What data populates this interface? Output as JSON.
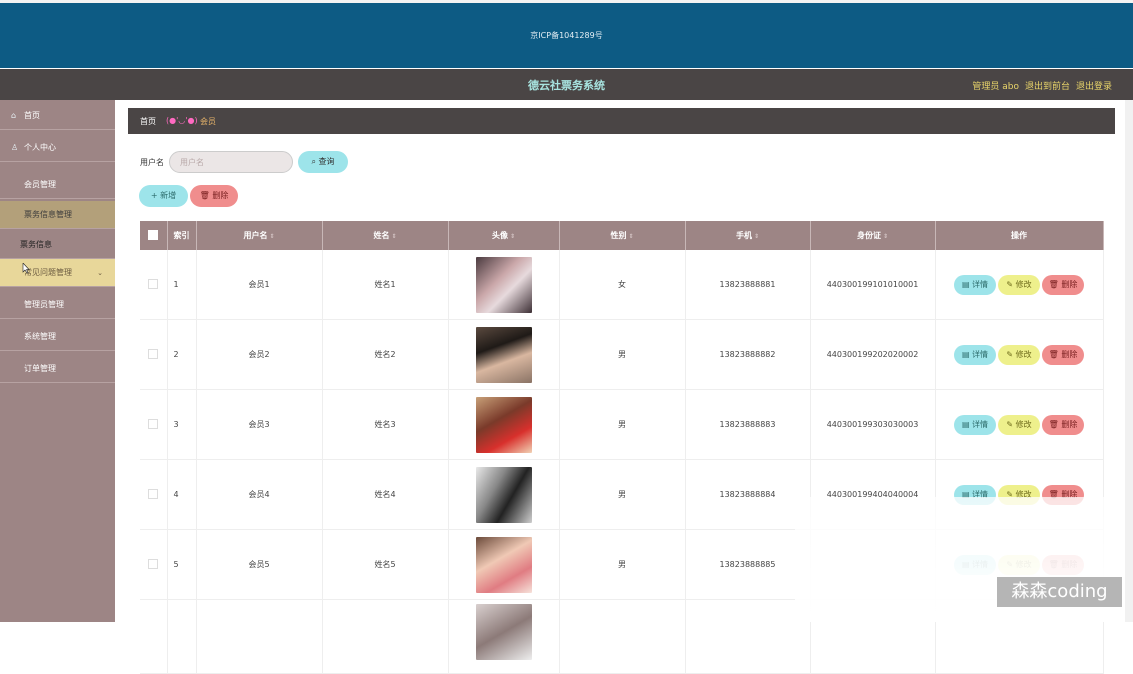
{
  "top": {
    "icp": "京ICP备1041289号"
  },
  "nav": {
    "title": "德云社票务系统",
    "admin": "管理员 abo",
    "back": "退出到前台",
    "logout": "退出登录"
  },
  "sidebar": {
    "items": [
      {
        "label": "首页",
        "icon": "home-icon"
      },
      {
        "label": "个人中心",
        "icon": "user-icon"
      },
      {
        "label": "会员管理",
        "icon": ""
      },
      {
        "label": "票务信息管理",
        "icon": ""
      },
      {
        "label": "票务信息",
        "icon": ""
      },
      {
        "label": "常见问题管理",
        "icon": ""
      },
      {
        "label": "管理员管理",
        "icon": ""
      },
      {
        "label": "系统管理",
        "icon": ""
      },
      {
        "label": "订单管理",
        "icon": ""
      }
    ]
  },
  "breadcrumb": {
    "home": "首页",
    "face": "(●'◡'●)",
    "current": "会员"
  },
  "search": {
    "label": "用户名",
    "placeholder": "用户名",
    "query": "查询"
  },
  "actions": {
    "add": "新增",
    "delete": "删除"
  },
  "table": {
    "headers": [
      "索引",
      "用户名",
      "姓名",
      "头像",
      "性别",
      "手机",
      "身份证",
      "操作"
    ],
    "rows": [
      {
        "idx": "1",
        "username": "会员1",
        "name": "姓名1",
        "gender": "女",
        "phone": "13823888881",
        "id": "440300199101010001"
      },
      {
        "idx": "2",
        "username": "会员2",
        "name": "姓名2",
        "gender": "男",
        "phone": "13823888882",
        "id": "440300199202020002"
      },
      {
        "idx": "3",
        "username": "会员3",
        "name": "姓名3",
        "gender": "男",
        "phone": "13823888883",
        "id": "440300199303030003"
      },
      {
        "idx": "4",
        "username": "会员4",
        "name": "姓名4",
        "gender": "男",
        "phone": "13823888884",
        "id": "440300199404040004"
      },
      {
        "idx": "5",
        "username": "会员5",
        "name": "姓名5",
        "gender": "男",
        "phone": "13823888885",
        "id": ""
      }
    ],
    "row_actions": {
      "detail": "详情",
      "edit": "修改",
      "delete": "删除"
    }
  },
  "watermark": "森森coding"
}
